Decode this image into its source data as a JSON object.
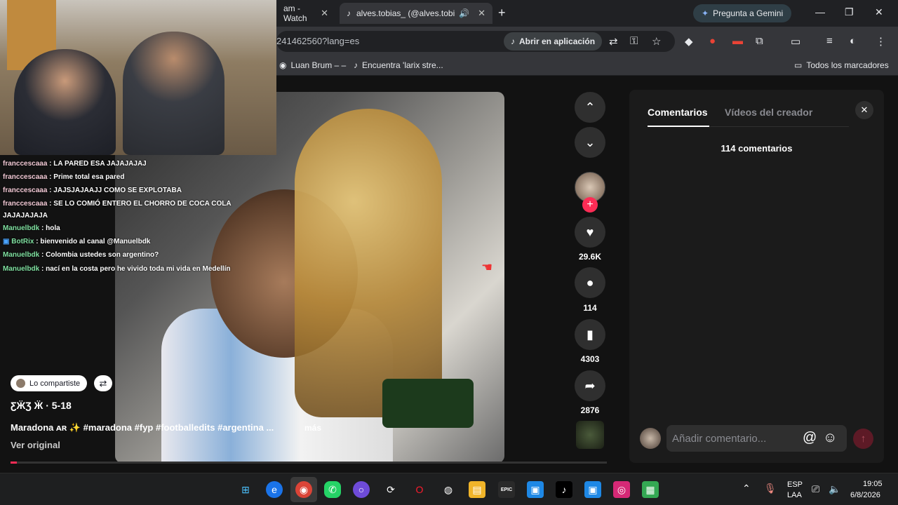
{
  "browser": {
    "tabs": [
      {
        "label": "am - Watch"
      },
      {
        "label": "alves.tobias_ (@alves.tobias"
      }
    ],
    "gemini_label": "Pregunta a Gemini",
    "url": "241462560?lang=es",
    "open_app_label": "Abrir en aplicación",
    "bookmarks": [
      {
        "label": "Luan Brum – –"
      },
      {
        "label": "Encuentra 'larix stre..."
      }
    ],
    "all_bookmarks_label": "Todos los marcadores"
  },
  "video": {
    "actions": {
      "likes": "29.6K",
      "comments": "114",
      "saves": "4303",
      "shares": "2876"
    }
  },
  "post": {
    "shared_label": "Lo compartiste",
    "author": "ƸӜƷ Ӝ · 5-18",
    "caption": "Maradona ᴀʀ ✨ #maradona #fyp #footballedits #argentina ...",
    "more_label": "más",
    "see_original": "Ver original",
    "progress": 0.01
  },
  "comments_panel": {
    "tab_comments": "Comentarios",
    "tab_creator": "Vídeos del creador",
    "count": "114 comentarios",
    "input_placeholder": "Añadir comentario..."
  },
  "chat": [
    {
      "user": "franccescaaa",
      "text": ": LA PARED ESA JAJAJAJAJ"
    },
    {
      "user": "franccescaaa",
      "text": ": Prime total esa pared"
    },
    {
      "user": "franccescaaa",
      "text": ": JAJSJAJAAJJ COMO SE EXPLOTABA"
    },
    {
      "user": "franccescaaa",
      "text": ": SE LO COMIÓ ENTERO EL CHORRO DE COCA COLA"
    },
    {
      "user": "",
      "text": "JAJAJAJAJA"
    },
    {
      "user": "Manuelbdk",
      "text": ": hola"
    },
    {
      "user": "BotRix",
      "text": ": bienvenido al canal @Manuelbdk"
    },
    {
      "user": "Manuelbdk",
      "text": ": Colombia ustedes son argentino?"
    },
    {
      "user": "Manuelbdk",
      "text": ": nací en la costa pero he vivido toda mi vida en Medellín"
    }
  ],
  "taskbar": {
    "lang": "ESP",
    "lang2": "LAA",
    "time": "19:05",
    "date": "6/8/2026",
    "epic_label": "EPIC"
  },
  "colors": {
    "tiktok_red": "#fe2c55",
    "chrome_dark": "#202124",
    "panel_bg": "#1b1b1b"
  }
}
